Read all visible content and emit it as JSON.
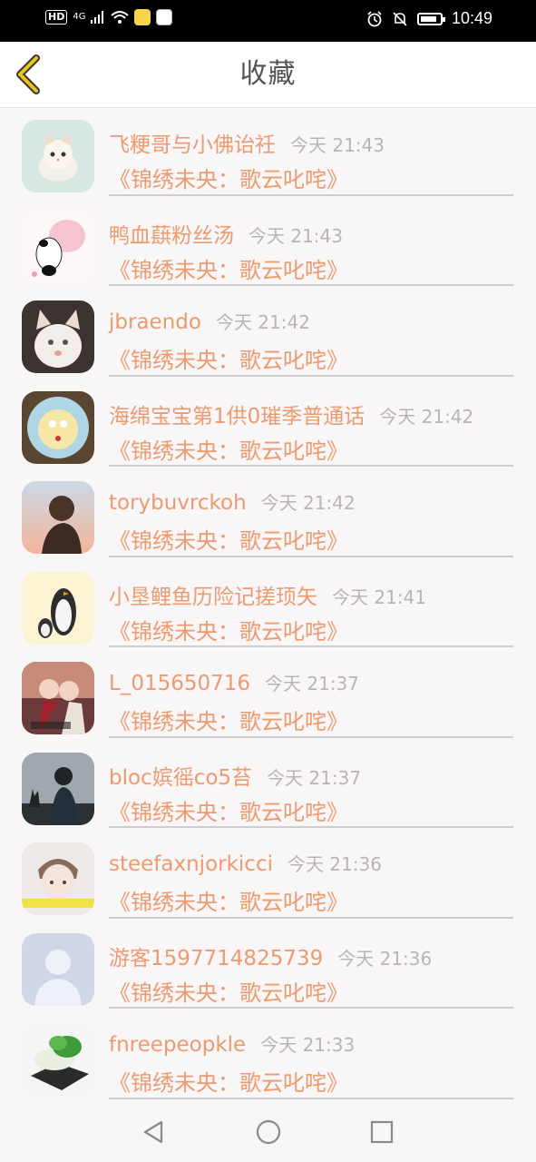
{
  "status_bar": {
    "hd": "HD",
    "network": "4G",
    "wifi_sub": "4G",
    "time": "10:49"
  },
  "header": {
    "title": "收藏"
  },
  "favorites": [
    {
      "user": "飞粳哥与小佛诒祍",
      "time": "今天 21:43",
      "book": "《锦绣未央：歌云叱咤》",
      "avatar": "kitten-photo"
    },
    {
      "user": "鸭血蕻粉丝汤",
      "time": "今天 21:43",
      "book": "《锦绣未央：歌云叱咤》",
      "avatar": "panda-cartoon"
    },
    {
      "user": "jbraendo",
      "time": "今天 21:42",
      "book": "《锦绣未央：歌云叱咤》",
      "avatar": "white-kitten-photo"
    },
    {
      "user": "海绵宝宝第1供0璀季普通话",
      "time": "今天 21:42",
      "book": "《锦绣未央：歌云叱咤》",
      "avatar": "plate-food-photo"
    },
    {
      "user": "torybuvrckoh",
      "time": "今天 21:42",
      "book": "《锦绣未央：歌云叱咤》",
      "avatar": "boy-sunset-photo"
    },
    {
      "user": "小垦鲤鱼历险记搓顼矢",
      "time": "今天 21:41",
      "book": "《锦绣未央：歌云叱咤》",
      "avatar": "cartoon-penguins"
    },
    {
      "user": "L_015650716",
      "time": "今天 21:37",
      "book": "《锦绣未央：歌云叱咤》",
      "avatar": "anime-couple"
    },
    {
      "user": "bloc嫔徭co5苔",
      "time": "今天 21:37",
      "book": "《锦绣未央：歌云叱咤》",
      "avatar": "man-silhouette-photo"
    },
    {
      "user": "steefaxnjorkicci",
      "time": "今天 21:36",
      "book": "《锦绣未央：歌云叱咤》",
      "avatar": "boy-portrait"
    },
    {
      "user": "游客1597714825739",
      "time": "今天 21:36",
      "book": "《锦绣未央：歌云叱咤》",
      "avatar": "default-user"
    },
    {
      "user": "fnreepeopkle",
      "time": "今天 21:33",
      "book": "《锦绣未央：歌云叱咤》",
      "avatar": "jade-cabbage-photo"
    }
  ],
  "colors": {
    "accent": "#ec9a6f",
    "time_gray": "#b9b5b5",
    "back_arrow": "#e8c21d",
    "background": "#f8f6f7"
  }
}
